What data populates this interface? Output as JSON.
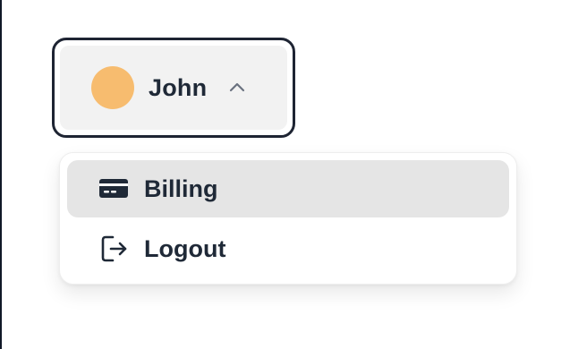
{
  "user": {
    "name": "John",
    "avatar_color": "#f7bc6f",
    "expanded_icon": "chevron-up-icon"
  },
  "menu": {
    "items": [
      {
        "label": "Billing",
        "icon": "credit-card-icon",
        "highlighted": true
      },
      {
        "label": "Logout",
        "icon": "logout-icon",
        "highlighted": false
      }
    ]
  },
  "colors": {
    "text": "#1f2937",
    "trigger_border": "#1e2433",
    "trigger_bg": "#f2f2f2",
    "active_item_bg": "#e5e5e5",
    "chevron": "#6b7280"
  }
}
